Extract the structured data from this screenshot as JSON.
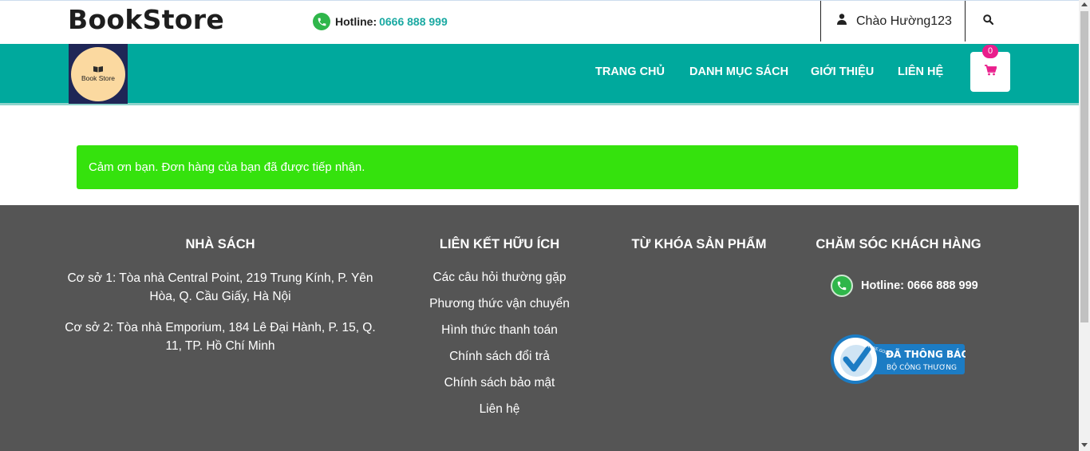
{
  "header": {
    "brand": "BookStore",
    "hotline_label": "Hotline:",
    "hotline_number": "0666 888 999",
    "greeting": "Chào Hường123"
  },
  "nav": {
    "logo_text": "Book Store",
    "items": [
      {
        "label": "TRANG CHỦ"
      },
      {
        "label": "DANH MỤC SÁCH"
      },
      {
        "label": "GIỚI THIỆU"
      },
      {
        "label": "LIÊN HỆ"
      }
    ],
    "cart_count": "0"
  },
  "main": {
    "success_message": "Cảm ơn bạn. Đơn hàng của bạn đã được tiếp nhận."
  },
  "footer": {
    "col1": {
      "title": "NHÀ SÁCH",
      "address1": "Cơ sở 1: Tòa nhà Central Point, 219 Trung Kính, P. Yên Hòa, Q. Cầu Giấy, Hà Nội",
      "address2": "Cơ sở 2: Tòa nhà Emporium, 184 Lê Đại Hành, P. 15, Q. 11, TP. Hồ Chí Minh"
    },
    "col2": {
      "title": "LIÊN KẾT HỮU ÍCH",
      "links": [
        "Các câu hỏi thường gặp",
        "Phương thức vận chuyển",
        "Hình thức thanh toán",
        "Chính sách đổi trả",
        "Chính sách bảo mật",
        "Liên hệ"
      ]
    },
    "col3": {
      "title": "TỪ KHÓA SẢN PHẨM"
    },
    "col4": {
      "title": "CHĂM SÓC KHÁCH HÀNG",
      "hotline": "Hotline: 0666 888 999",
      "badge_line1": "ĐÃ THÔNG BÁO",
      "badge_line2": "BỘ CÔNG THƯƠNG",
      "badge_seal_text": "ONLINE.GOV.VN"
    }
  },
  "colors": {
    "nav_bg": "#00a99d",
    "success_bg": "#35e20d",
    "footer_bg": "#555555",
    "cart_badge": "#e91e8c",
    "hotline_accent": "#1aa9a2"
  }
}
